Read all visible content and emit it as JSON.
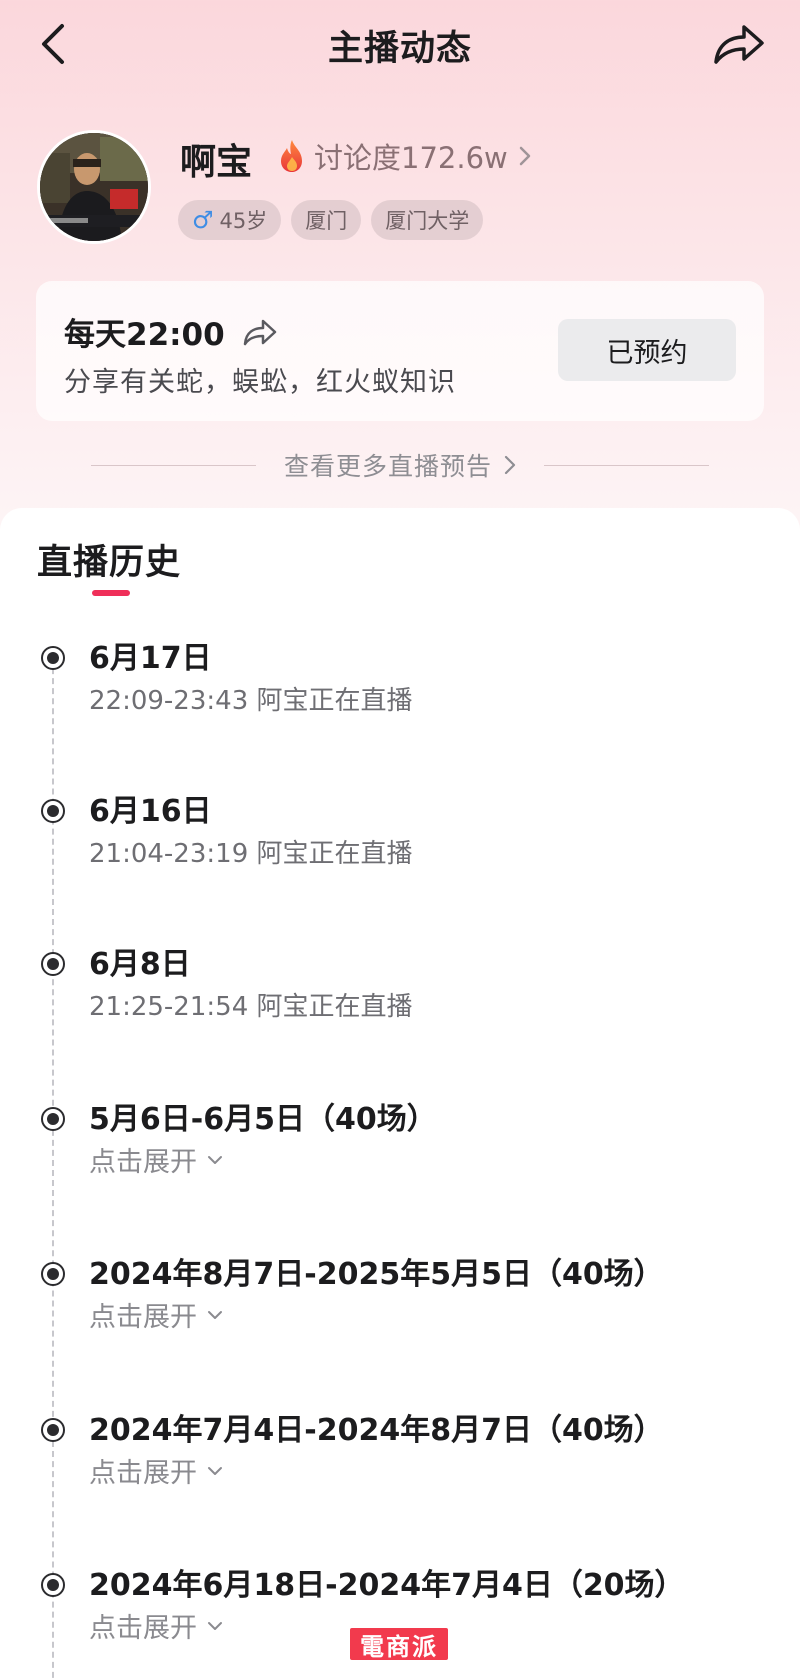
{
  "header": {
    "title": "主播动态"
  },
  "profile": {
    "name": "啊宝",
    "heat_label": "讨论度172.6w",
    "tags": {
      "age": "45岁",
      "city": "厦门",
      "school": "厦门大学"
    }
  },
  "schedule": {
    "time": "每天22:00",
    "description": "分享有关蛇，蜈蚣，红火蚁知识",
    "reserve_label": "已预约"
  },
  "more_previews": {
    "label": "查看更多直播预告"
  },
  "history": {
    "title": "直播历史",
    "items": [
      {
        "date": "6月17日",
        "detail": "22:09-23:43 阿宝正在直播"
      },
      {
        "date": "6月16日",
        "detail": "21:04-23:19 阿宝正在直播"
      },
      {
        "date": "6月8日",
        "detail": "21:25-21:54 阿宝正在直播"
      },
      {
        "date": "5月6日-6月5日（40场）",
        "expand_label": "点击展开"
      },
      {
        "date": "2024年8月7日-2025年5月5日（40场）",
        "expand_label": "点击展开"
      },
      {
        "date": "2024年7月4日-2024年8月7日（40场）",
        "expand_label": "点击展开"
      },
      {
        "date": "2024年6月18日-2024年7月4日（20场）",
        "expand_label": "点击展开"
      }
    ]
  },
  "watermark": "電商派",
  "colors": {
    "accent": "#ef2f59",
    "gender_icon": "#3e8de5",
    "heat_flame": "#f2543a",
    "watermark_bg": "#f23a4d"
  },
  "icons": [
    "back-arrow-icon",
    "share-arrow-icon",
    "flame-icon",
    "male-icon",
    "chevron-right-icon",
    "chevron-down-icon",
    "timeline-dot-icon"
  ]
}
